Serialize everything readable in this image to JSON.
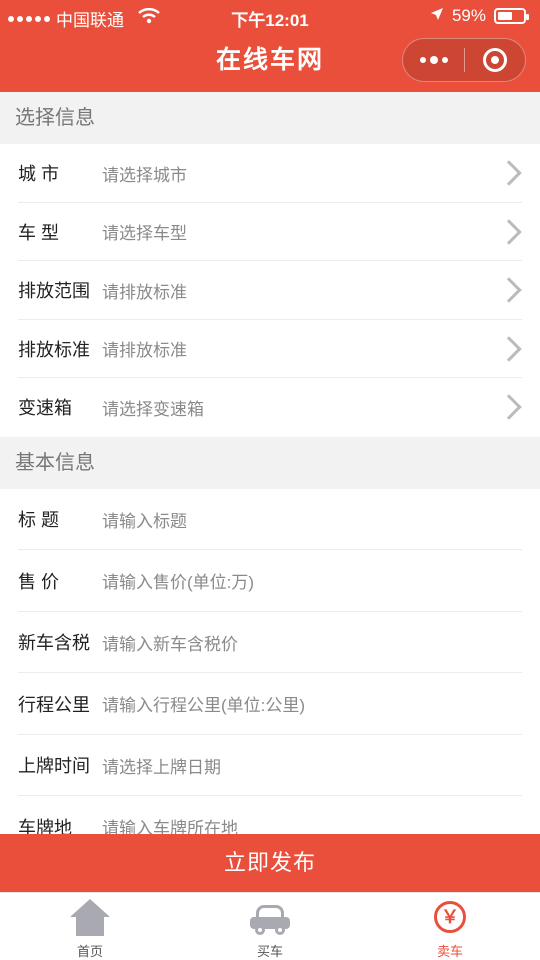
{
  "status": {
    "carrier": "中国联通",
    "time": "下午12:01",
    "battery": "59%",
    "battery_level": 0.59
  },
  "nav": {
    "title": "在线车网"
  },
  "select_section": {
    "title": "选择信息",
    "rows": [
      {
        "label": "城 市",
        "placeholder": "请选择城市"
      },
      {
        "label": "车 型",
        "placeholder": "请选择车型"
      },
      {
        "label": "排放范围",
        "placeholder": "请排放标准"
      },
      {
        "label": "排放标准",
        "placeholder": "请排放标准"
      },
      {
        "label": "变速箱",
        "placeholder": "请选择变速箱"
      }
    ]
  },
  "basic_section": {
    "title": "基本信息",
    "rows": [
      {
        "label": "标 题",
        "placeholder": "请输入标题"
      },
      {
        "label": "售 价",
        "placeholder": "请输入售价(单位:万)"
      },
      {
        "label": "新车含税",
        "placeholder": "请输入新车含税价"
      },
      {
        "label": "行程公里",
        "placeholder": "请输入行程公里(单位:公里)"
      },
      {
        "label": "上牌时间",
        "placeholder": "请选择上牌日期"
      },
      {
        "label": "车牌地",
        "placeholder": "请输入车牌所在地"
      }
    ]
  },
  "publish_label": "立即发布",
  "tabbar": {
    "items": [
      {
        "label": "首页",
        "icon": "home-icon",
        "active": false
      },
      {
        "label": "买车",
        "icon": "car-icon",
        "active": false
      },
      {
        "label": "卖车",
        "icon": "sell-icon",
        "active": true,
        "icon_text": "￥"
      }
    ]
  },
  "colors": {
    "brand": "#ea4f3b",
    "background": "#f2f2f2",
    "placeholder": "#8a8a8a"
  }
}
